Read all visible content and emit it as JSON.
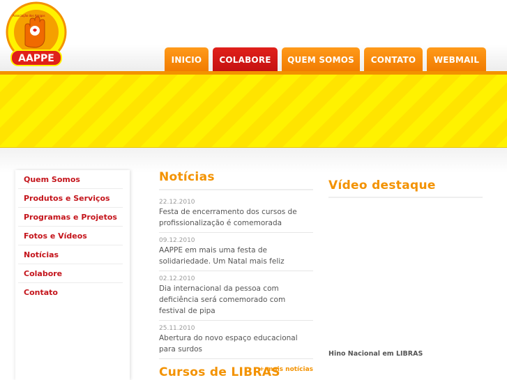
{
  "logo": {
    "brand_text": "AAPPE",
    "ring_text": "Associação dos Amigos e Pais de Pessoas Especiais"
  },
  "nav": {
    "tabs": [
      {
        "label": "INICIO",
        "active": false
      },
      {
        "label": "COLABORE",
        "active": true
      },
      {
        "label": "QUEM SOMOS",
        "active": false
      },
      {
        "label": "CONTATO",
        "active": false
      },
      {
        "label": "WEBMAIL",
        "active": false
      }
    ]
  },
  "sidebar": {
    "items": [
      {
        "label": "Quem Somos"
      },
      {
        "label": "Produtos e Serviços"
      },
      {
        "label": "Programas e Projetos"
      },
      {
        "label": "Fotos e Vídeos"
      },
      {
        "label": "Notícias"
      },
      {
        "label": "Colabore"
      },
      {
        "label": "Contato"
      }
    ]
  },
  "news": {
    "title": "Notícias",
    "items": [
      {
        "date": "22.12.2010",
        "text": "Festa de encerramento dos cursos de profissionalização é comemorada"
      },
      {
        "date": "09.12.2010",
        "text": "AAPPE em mais uma festa de solidariedade. Um Natal mais feliz"
      },
      {
        "date": "02.12.2010",
        "text": "Dia internacional da pessoa com deficiência será comemorado com festival de pipa"
      },
      {
        "date": "25.11.2010",
        "text": "Abertura do novo espaço educacional para surdos"
      }
    ],
    "more_label": "+ mais notícias"
  },
  "cursos": {
    "title": "Cursos de LIBRAS"
  },
  "video": {
    "title": "Vídeo destaque",
    "caption": "Hino Nacional em LIBRAS"
  },
  "colors": {
    "orange": "#f39200",
    "red": "#c4141b",
    "yellow": "#fff200"
  }
}
